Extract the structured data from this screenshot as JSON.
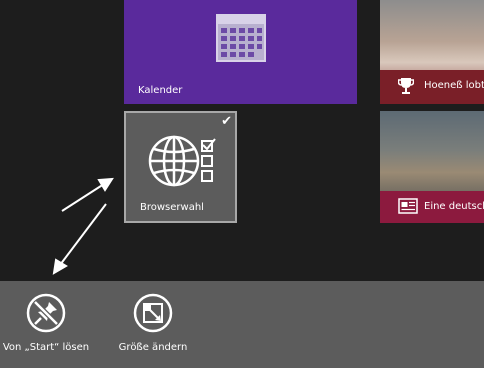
{
  "tiles": {
    "calendar": {
      "label": "Kalender",
      "color": "#5a2a9c"
    },
    "browser": {
      "label": "Browserwahl",
      "selected": true,
      "color": "#5c5c5c"
    },
    "sport": {
      "label": "Hoeneß lobt",
      "color": "#7a1f28"
    },
    "news": {
      "label": "Eine deutsch",
      "color": "#8c1a3e"
    }
  },
  "appbar": {
    "unpin_label": "Von „Start“ lösen",
    "resize_label": "Größe ändern",
    "color": "#5c5c5c"
  }
}
